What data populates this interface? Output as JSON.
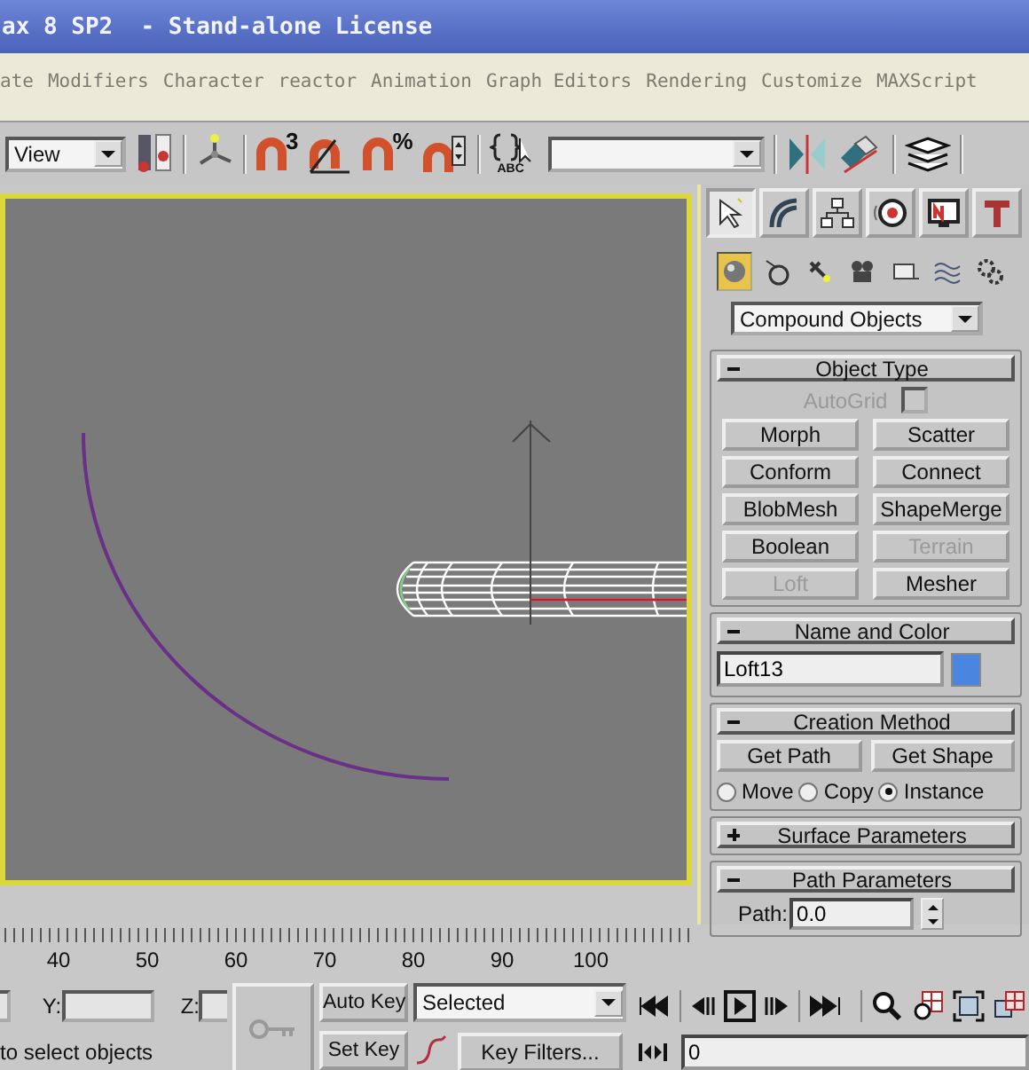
{
  "window": {
    "title": "ax 8 SP2  - Stand-alone License"
  },
  "menu": [
    {
      "label": "ate"
    },
    {
      "label": "Modifiers"
    },
    {
      "label": "Character"
    },
    {
      "label": "reactor"
    },
    {
      "label": "Animation"
    },
    {
      "label": "Graph Editors"
    },
    {
      "label": "Rendering"
    },
    {
      "label": "Customize"
    },
    {
      "label": "MAXScript"
    }
  ],
  "toolbar": {
    "view_dropdown": "View",
    "snap_count": "3",
    "percent_sign": "%",
    "abc_label": "ABC"
  },
  "command_panel": {
    "tabs": [
      {
        "kind": "create",
        "selected": true
      },
      {
        "kind": "modify",
        "selected": false
      },
      {
        "kind": "hierarchy",
        "selected": false
      },
      {
        "kind": "motion",
        "selected": false
      },
      {
        "kind": "display",
        "selected": false
      },
      {
        "kind": "utilities",
        "selected": false
      }
    ],
    "categories": [
      {
        "kind": "geometry",
        "selected": true
      },
      {
        "kind": "shapes",
        "selected": false
      },
      {
        "kind": "lights",
        "selected": false
      },
      {
        "kind": "cameras",
        "selected": false
      },
      {
        "kind": "helpers",
        "selected": false
      },
      {
        "kind": "spacewarps",
        "selected": false
      },
      {
        "kind": "systems",
        "selected": false
      }
    ],
    "type_dropdown": "Compound Objects",
    "object_type": {
      "title": "Object Type",
      "expanded": true,
      "autogrid": {
        "label": "AutoGrid",
        "checked": false,
        "disabled": true
      },
      "buttons": [
        {
          "label": "Morph",
          "disabled": false
        },
        {
          "label": "Scatter",
          "disabled": false
        },
        {
          "label": "Conform",
          "disabled": false
        },
        {
          "label": "Connect",
          "disabled": false
        },
        {
          "label": "BlobMesh",
          "disabled": false
        },
        {
          "label": "ShapeMerge",
          "disabled": false
        },
        {
          "label": "Boolean",
          "disabled": false
        },
        {
          "label": "Terrain",
          "disabled": true
        },
        {
          "label": "Loft",
          "disabled": true
        },
        {
          "label": "Mesher",
          "disabled": false
        }
      ]
    },
    "name_and_color": {
      "title": "Name and Color",
      "expanded": true,
      "name": "Loft13",
      "color": "#4a86e0"
    },
    "creation_method": {
      "title": "Creation Method",
      "expanded": true,
      "buttons": [
        "Get Path",
        "Get Shape"
      ],
      "options": [
        {
          "label": "Move",
          "selected": false
        },
        {
          "label": "Copy",
          "selected": false
        },
        {
          "label": "Instance",
          "selected": true
        }
      ]
    },
    "surface_parameters": {
      "title": "Surface Parameters",
      "expanded": false
    },
    "path_parameters": {
      "title": "Path Parameters",
      "expanded": true,
      "path_label": "Path:",
      "path_value": "0.0"
    }
  },
  "timeline": {
    "labels": [
      "40",
      "50",
      "60",
      "70",
      "80",
      "90",
      "100"
    ]
  },
  "bottom": {
    "y_label": "Y:",
    "z_label": "Z:",
    "status": "to select objects",
    "auto_key": "Auto Key",
    "set_key": "Set Key",
    "key_mode": "Selected",
    "key_filters": "Key Filters...",
    "frame": "0"
  }
}
